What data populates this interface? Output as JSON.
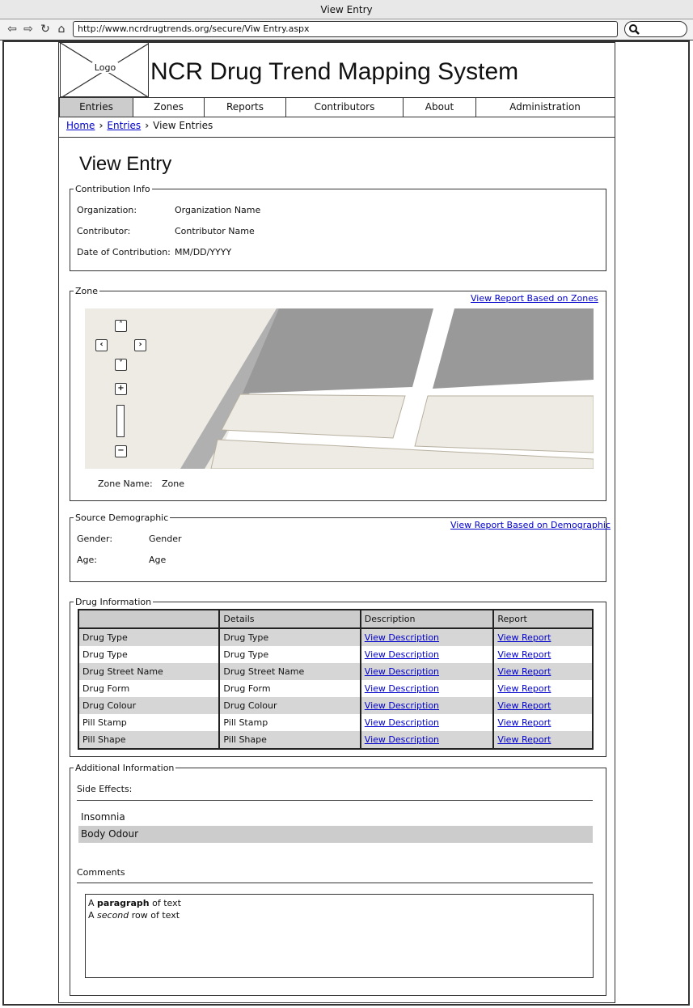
{
  "browser": {
    "window_title": "View Entry",
    "url": "http://www.ncrdrugtrends.org/secure/Viw Entry.aspx"
  },
  "header": {
    "logo_text": "Logo",
    "site_title": "NCR Drug Trend Mapping System"
  },
  "menu": {
    "items": [
      "Entries",
      "Zones",
      "Reports",
      "Contributors",
      "About",
      "Administration"
    ],
    "active": "Entries"
  },
  "breadcrumb": [
    "Home",
    "Entries",
    "View Entries"
  ],
  "page_title": "View Entry",
  "contribution": {
    "legend": "Contribution Info",
    "rows": [
      {
        "label": "Organization:",
        "value": "Organization Name"
      },
      {
        "label": "Contributor:",
        "value": "Contributor Name"
      },
      {
        "label": "Date of Contribution:",
        "value": "MM/DD/YYYY"
      }
    ]
  },
  "zone": {
    "legend": "Zone",
    "report_link": "View Report Based on Zones",
    "name_label": "Zone Name:",
    "name_value": "Zone"
  },
  "demographic": {
    "legend": "Source Demographic",
    "report_link": "View Report Based on Demographic",
    "rows": [
      {
        "label": "Gender:",
        "value": "Gender"
      },
      {
        "label": "Age:",
        "value": "Age"
      }
    ]
  },
  "drug": {
    "legend": "Drug Information",
    "columns": [
      "",
      "Details",
      "Description",
      "Report"
    ],
    "rows": [
      [
        "Drug Type",
        "Drug Type",
        "View Description",
        "View Report"
      ],
      [
        "Drug Type",
        "Drug Type",
        "View Description",
        "View Report"
      ],
      [
        "Drug Street Name",
        "Drug Street Name",
        "View Description",
        "View Report"
      ],
      [
        "Drug Form",
        "Drug Form",
        "View Description",
        "View Report"
      ],
      [
        "Drug Colour",
        "Drug Colour",
        "View Description",
        "View Report"
      ],
      [
        "Pill Stamp",
        "Pill Stamp",
        "View Description",
        "View Report"
      ],
      [
        "Pill Shape",
        "Pill Shape",
        "View Description",
        "View Report"
      ]
    ]
  },
  "additional": {
    "legend": "Additional Information",
    "side_effects_label": "Side Effects:",
    "side_effects": [
      "Insomnia",
      "Body Odour"
    ],
    "comments_label": "Comments",
    "comments": {
      "line1": {
        "pre": "A ",
        "bold": "paragraph",
        "post": " of text"
      },
      "line2": {
        "pre": "A ",
        "italic": "second",
        "post": " row of text"
      }
    }
  },
  "colors": {
    "link": "#0000cc",
    "active_tab": "#cccccc",
    "map_background": "#eeebe4",
    "map_block": "#999999",
    "map_road": "#b0b0b0"
  }
}
